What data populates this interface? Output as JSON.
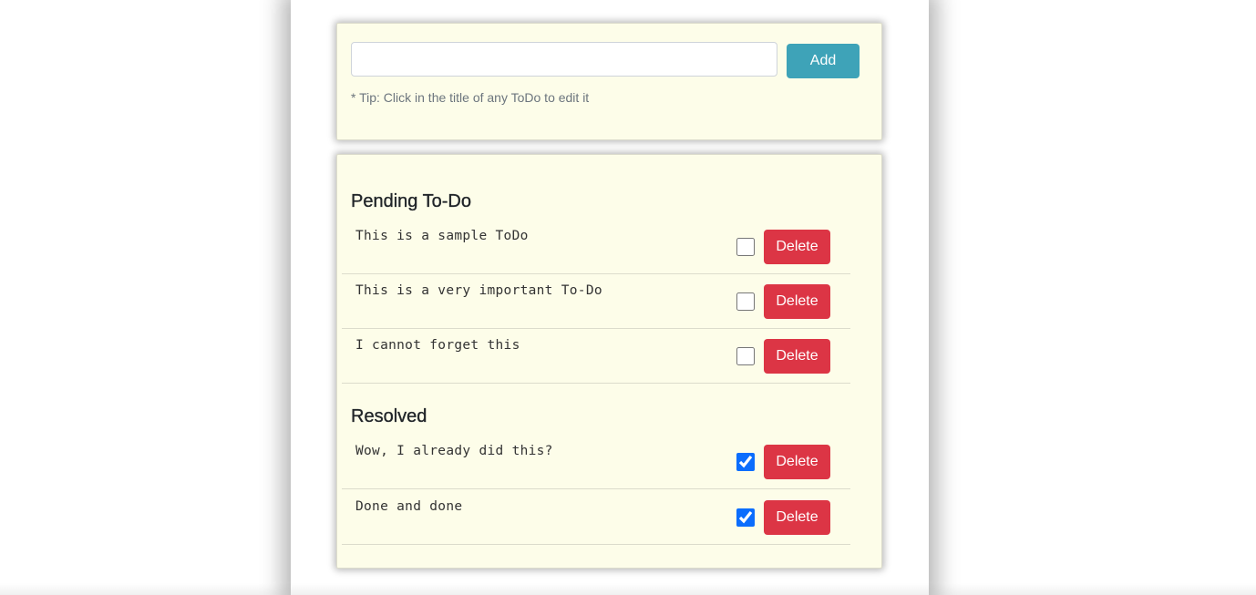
{
  "add_form": {
    "input_value": "",
    "input_placeholder": "",
    "add_label": "Add",
    "tip": "* Tip: Click in the title of any ToDo to edit it"
  },
  "pending": {
    "heading": "Pending To-Do",
    "items": [
      {
        "title": "This is a sample ToDo",
        "done": false,
        "delete_label": "Delete"
      },
      {
        "title": "This is a very important To-Do",
        "done": false,
        "delete_label": "Delete"
      },
      {
        "title": "I cannot forget this",
        "done": false,
        "delete_label": "Delete"
      }
    ]
  },
  "resolved": {
    "heading": "Resolved",
    "items": [
      {
        "title": "Wow, I already did this?",
        "done": true,
        "delete_label": "Delete"
      },
      {
        "title": "Done and done",
        "done": true,
        "delete_label": "Delete"
      }
    ]
  },
  "colors": {
    "card_background": "#fdfde9",
    "add_button": "#3ea3b8",
    "delete_button": "#dc3545",
    "checkbox_checked": "#0b6dfd"
  }
}
